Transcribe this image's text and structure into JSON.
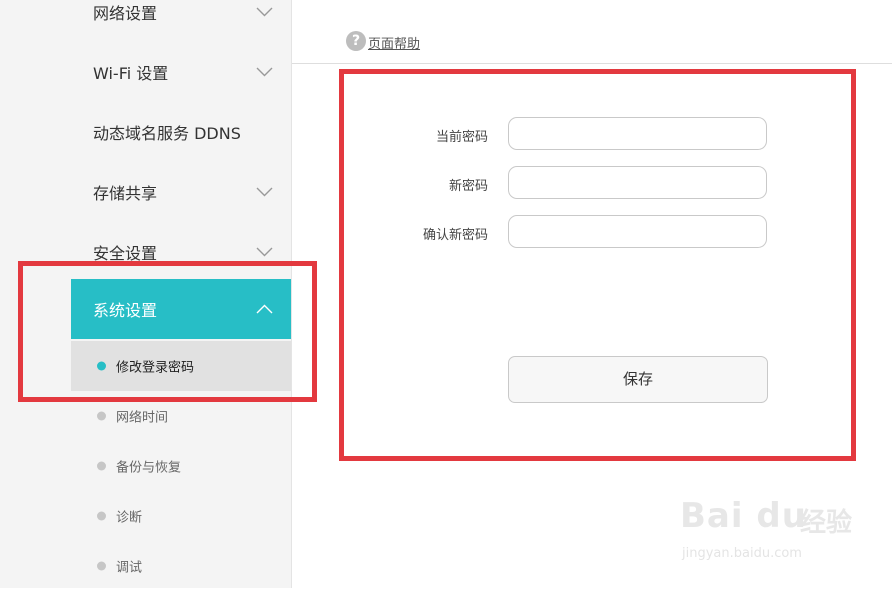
{
  "sidebar": {
    "items": [
      {
        "label": "网络设置"
      },
      {
        "label": "Wi-Fi 设置"
      },
      {
        "label": "动态域名服务 DDNS"
      },
      {
        "label": "存储共享"
      },
      {
        "label": "安全设置"
      },
      {
        "label": "系统设置"
      }
    ],
    "subitems": [
      {
        "label": "修改登录密码"
      },
      {
        "label": "网络时间"
      },
      {
        "label": "备份与恢复"
      },
      {
        "label": "诊断"
      },
      {
        "label": "调试"
      }
    ]
  },
  "help": {
    "icon": "?",
    "label": "页面帮助"
  },
  "form": {
    "current_password_label": "当前密码",
    "new_password_label": "新密码",
    "confirm_password_label": "确认新密码",
    "current_password_value": "",
    "new_password_value": "",
    "confirm_password_value": "",
    "save_label": "保存"
  },
  "watermark": {
    "logo": "Bai du",
    "name": "经验",
    "url": "jingyan.baidu.com"
  },
  "colors": {
    "accent": "#27bec6",
    "highlight_box": "#e3393f"
  }
}
